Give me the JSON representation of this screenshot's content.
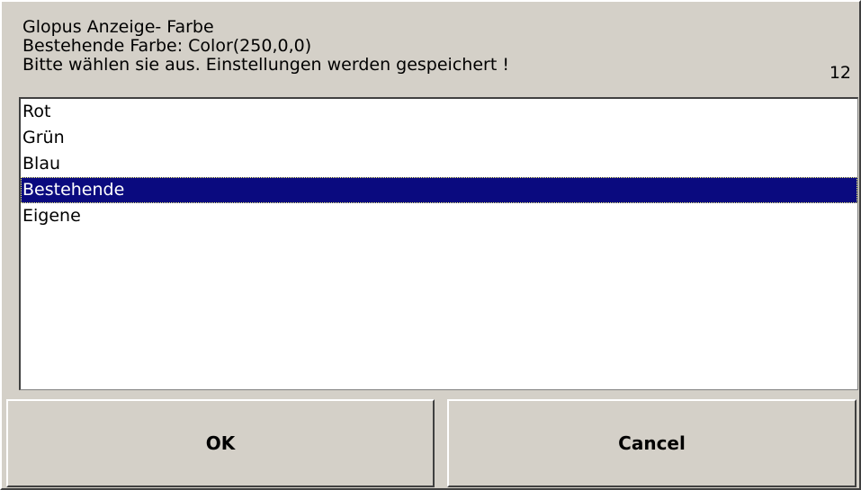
{
  "header": {
    "line1": "Glopus Anzeige- Farbe",
    "line2": "Bestehende Farbe: Color(250,0,0)",
    "line3": "Bitte wählen sie aus. Einstellungen werden gespeichert !",
    "counter": "12"
  },
  "list": {
    "items": [
      {
        "label": "Rot"
      },
      {
        "label": "Grün"
      },
      {
        "label": "Blau"
      },
      {
        "label": "Bestehende",
        "selected": true
      },
      {
        "label": "Eigene"
      }
    ]
  },
  "buttons": {
    "ok_label": "OK",
    "cancel_label": "Cancel"
  },
  "colors": {
    "dialog_background": "#d4d0c8",
    "selection_background": "#0a0a7f",
    "selection_text": "#ffffff"
  }
}
